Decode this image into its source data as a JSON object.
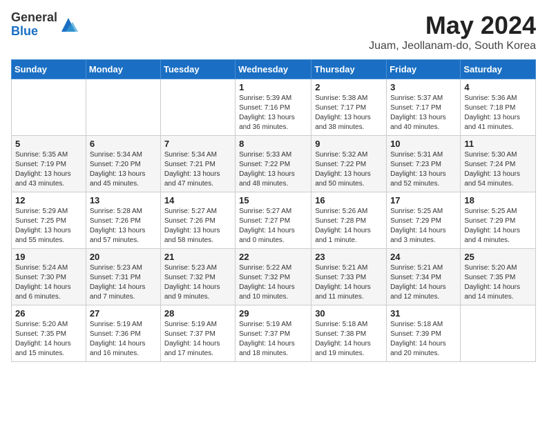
{
  "logo": {
    "general": "General",
    "blue": "Blue"
  },
  "header": {
    "title": "May 2024",
    "subtitle": "Juam, Jeollanam-do, South Korea"
  },
  "weekdays": [
    "Sunday",
    "Monday",
    "Tuesday",
    "Wednesday",
    "Thursday",
    "Friday",
    "Saturday"
  ],
  "weeks": [
    [
      {
        "day": "",
        "info": ""
      },
      {
        "day": "",
        "info": ""
      },
      {
        "day": "",
        "info": ""
      },
      {
        "day": "1",
        "info": "Sunrise: 5:39 AM\nSunset: 7:16 PM\nDaylight: 13 hours\nand 36 minutes."
      },
      {
        "day": "2",
        "info": "Sunrise: 5:38 AM\nSunset: 7:17 PM\nDaylight: 13 hours\nand 38 minutes."
      },
      {
        "day": "3",
        "info": "Sunrise: 5:37 AM\nSunset: 7:17 PM\nDaylight: 13 hours\nand 40 minutes."
      },
      {
        "day": "4",
        "info": "Sunrise: 5:36 AM\nSunset: 7:18 PM\nDaylight: 13 hours\nand 41 minutes."
      }
    ],
    [
      {
        "day": "5",
        "info": "Sunrise: 5:35 AM\nSunset: 7:19 PM\nDaylight: 13 hours\nand 43 minutes."
      },
      {
        "day": "6",
        "info": "Sunrise: 5:34 AM\nSunset: 7:20 PM\nDaylight: 13 hours\nand 45 minutes."
      },
      {
        "day": "7",
        "info": "Sunrise: 5:34 AM\nSunset: 7:21 PM\nDaylight: 13 hours\nand 47 minutes."
      },
      {
        "day": "8",
        "info": "Sunrise: 5:33 AM\nSunset: 7:22 PM\nDaylight: 13 hours\nand 48 minutes."
      },
      {
        "day": "9",
        "info": "Sunrise: 5:32 AM\nSunset: 7:22 PM\nDaylight: 13 hours\nand 50 minutes."
      },
      {
        "day": "10",
        "info": "Sunrise: 5:31 AM\nSunset: 7:23 PM\nDaylight: 13 hours\nand 52 minutes."
      },
      {
        "day": "11",
        "info": "Sunrise: 5:30 AM\nSunset: 7:24 PM\nDaylight: 13 hours\nand 54 minutes."
      }
    ],
    [
      {
        "day": "12",
        "info": "Sunrise: 5:29 AM\nSunset: 7:25 PM\nDaylight: 13 hours\nand 55 minutes."
      },
      {
        "day": "13",
        "info": "Sunrise: 5:28 AM\nSunset: 7:26 PM\nDaylight: 13 hours\nand 57 minutes."
      },
      {
        "day": "14",
        "info": "Sunrise: 5:27 AM\nSunset: 7:26 PM\nDaylight: 13 hours\nand 58 minutes."
      },
      {
        "day": "15",
        "info": "Sunrise: 5:27 AM\nSunset: 7:27 PM\nDaylight: 14 hours\nand 0 minutes."
      },
      {
        "day": "16",
        "info": "Sunrise: 5:26 AM\nSunset: 7:28 PM\nDaylight: 14 hours\nand 1 minute."
      },
      {
        "day": "17",
        "info": "Sunrise: 5:25 AM\nSunset: 7:29 PM\nDaylight: 14 hours\nand 3 minutes."
      },
      {
        "day": "18",
        "info": "Sunrise: 5:25 AM\nSunset: 7:29 PM\nDaylight: 14 hours\nand 4 minutes."
      }
    ],
    [
      {
        "day": "19",
        "info": "Sunrise: 5:24 AM\nSunset: 7:30 PM\nDaylight: 14 hours\nand 6 minutes."
      },
      {
        "day": "20",
        "info": "Sunrise: 5:23 AM\nSunset: 7:31 PM\nDaylight: 14 hours\nand 7 minutes."
      },
      {
        "day": "21",
        "info": "Sunrise: 5:23 AM\nSunset: 7:32 PM\nDaylight: 14 hours\nand 9 minutes."
      },
      {
        "day": "22",
        "info": "Sunrise: 5:22 AM\nSunset: 7:32 PM\nDaylight: 14 hours\nand 10 minutes."
      },
      {
        "day": "23",
        "info": "Sunrise: 5:21 AM\nSunset: 7:33 PM\nDaylight: 14 hours\nand 11 minutes."
      },
      {
        "day": "24",
        "info": "Sunrise: 5:21 AM\nSunset: 7:34 PM\nDaylight: 14 hours\nand 12 minutes."
      },
      {
        "day": "25",
        "info": "Sunrise: 5:20 AM\nSunset: 7:35 PM\nDaylight: 14 hours\nand 14 minutes."
      }
    ],
    [
      {
        "day": "26",
        "info": "Sunrise: 5:20 AM\nSunset: 7:35 PM\nDaylight: 14 hours\nand 15 minutes."
      },
      {
        "day": "27",
        "info": "Sunrise: 5:19 AM\nSunset: 7:36 PM\nDaylight: 14 hours\nand 16 minutes."
      },
      {
        "day": "28",
        "info": "Sunrise: 5:19 AM\nSunset: 7:37 PM\nDaylight: 14 hours\nand 17 minutes."
      },
      {
        "day": "29",
        "info": "Sunrise: 5:19 AM\nSunset: 7:37 PM\nDaylight: 14 hours\nand 18 minutes."
      },
      {
        "day": "30",
        "info": "Sunrise: 5:18 AM\nSunset: 7:38 PM\nDaylight: 14 hours\nand 19 minutes."
      },
      {
        "day": "31",
        "info": "Sunrise: 5:18 AM\nSunset: 7:39 PM\nDaylight: 14 hours\nand 20 minutes."
      },
      {
        "day": "",
        "info": ""
      }
    ]
  ]
}
